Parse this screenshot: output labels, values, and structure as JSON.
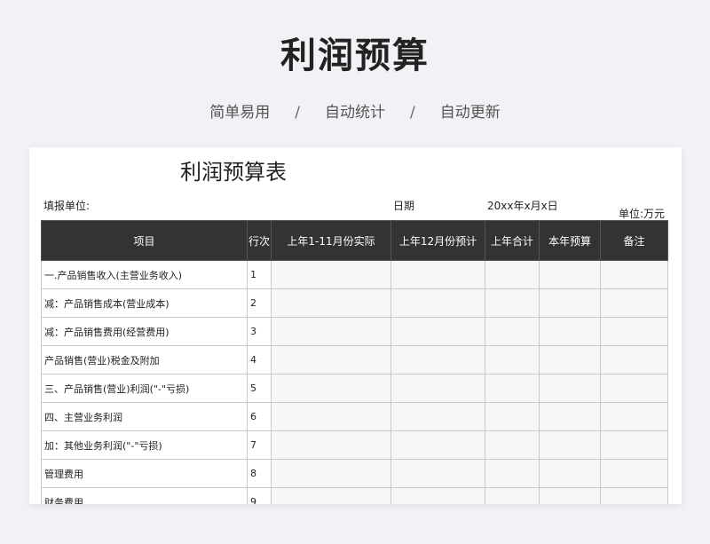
{
  "hero": {
    "title": "利润预算",
    "tags": [
      "简单易用",
      "自动统计",
      "自动更新"
    ],
    "separator": "/"
  },
  "sheet": {
    "title": "利润预算表",
    "unit_label": "填报单位:",
    "date_label": "日期",
    "date_value": "20xx年x月x日",
    "unit": "单位:万元",
    "columns": [
      "项目",
      "行次",
      "上年1-11月份实际",
      "上年12月份预计",
      "上年合计",
      "本年预算",
      "备注"
    ],
    "rows": [
      {
        "item": "一.产品销售收入(主营业务收入)",
        "no": "1"
      },
      {
        "item": "减：产品销售成本(营业成本)",
        "no": "2"
      },
      {
        "item": "减：产品销售费用(经营费用)",
        "no": "3"
      },
      {
        "item": "产品销售(营业)税金及附加",
        "no": "4"
      },
      {
        "item": "三、产品销售(营业)利润(\"-\"亏损)",
        "no": "5"
      },
      {
        "item": "四、主营业务利润",
        "no": "6"
      },
      {
        "item": "加：其他业务利润(\"-\"亏损)",
        "no": "7"
      },
      {
        "item": "管理费用",
        "no": "8"
      },
      {
        "item": "财务费用",
        "no": "9"
      }
    ]
  }
}
